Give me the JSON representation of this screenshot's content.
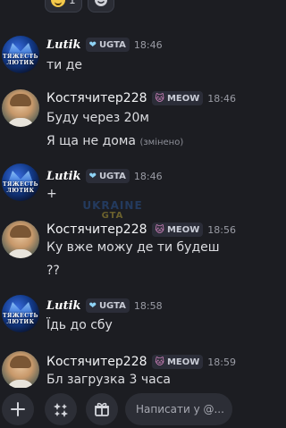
{
  "reactions": [
    {
      "emoji": "slightly-smiling-emoji",
      "count": "1"
    },
    {
      "emoji": "add-reaction-icon",
      "count": ""
    }
  ],
  "messages": [
    {
      "author": "Lutik",
      "tag_label": "UGTA",
      "tag_icon": "heart-icon",
      "time": "18:46",
      "avatar_text": "ТЯЖЕСТЬ ЛЮТИК",
      "lines": [
        "ти де"
      ]
    },
    {
      "author": "Костячитер228",
      "tag_label": "MEOW",
      "tag_icon": "cat-icon",
      "time": "18:46",
      "lines": [
        "Буду через 20м",
        "Я ща не дома"
      ],
      "edited_note": "(змінено)"
    },
    {
      "author": "Lutik",
      "tag_label": "UGTA",
      "tag_icon": "heart-icon",
      "time": "18:46",
      "avatar_text": "ТЯЖЕСТЬ ЛЮТИК",
      "lines": [
        "+"
      ]
    },
    {
      "author": "Костячитер228",
      "tag_label": "MEOW",
      "tag_icon": "cat-icon",
      "time": "18:56",
      "lines": [
        "Ку вже можу де ти будеш",
        "??"
      ]
    },
    {
      "author": "Lutik",
      "tag_label": "UGTA",
      "tag_icon": "heart-icon",
      "time": "18:58",
      "avatar_text": "ТЯЖЕСТЬ ЛЮТИК",
      "lines": [
        "Їдь до сбу"
      ]
    },
    {
      "author": "Костячитер228",
      "tag_label": "MEOW",
      "tag_icon": "cat-icon",
      "time": "18:59",
      "lines": [
        "Бл загрузка 3 часа"
      ]
    }
  ],
  "watermark": {
    "line1": "UKRAINE",
    "line2": "GTA"
  },
  "composer": {
    "add_icon": "plus-icon",
    "apps_icon": "apps-icon",
    "gift_icon": "gift-icon",
    "placeholder": "Написати у @..."
  },
  "colors": {
    "background": "#1c1d22",
    "text": "#dcdde1",
    "muted": "#9a9ca5",
    "tag_bg": "#2b2d38",
    "heart": "#8fd3f5",
    "cat": "#e88fd0"
  }
}
